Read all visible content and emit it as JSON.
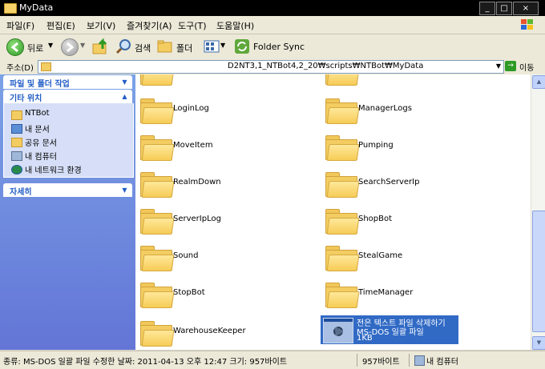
{
  "window": {
    "title": "MyData"
  },
  "menu": [
    "파일(F)",
    "편집(E)",
    "보기(V)",
    "즐겨찾기(A)",
    "도구(T)",
    "도움말(H)"
  ],
  "toolbar": {
    "back": "뒤로",
    "search": "검색",
    "folders": "폴더",
    "folder_sync": "Folder Sync"
  },
  "address": {
    "label": "주소(D)",
    "path": "D2NT3,1_NTBot4,2_20₩scripts₩NTBot₩MyData",
    "go": "이동"
  },
  "left_pane": {
    "group1": "파일 및 폴더 작업",
    "group2": "기타 위치",
    "places": [
      "NTBot",
      "내 문서",
      "공유 문서",
      "내 컴퓨터",
      "내 네트워크 환경"
    ],
    "group3": "자세히"
  },
  "files": [
    "LoginLog",
    "ManagerLogs",
    "MoveItem",
    "Pumping",
    "RealmDown",
    "SearchServerIp",
    "ServerIpLog",
    "ShopBot",
    "Sound",
    "StealGame",
    "StopBot",
    "TimeManager",
    "WarehouseKeeper"
  ],
  "selected_file": {
    "name": "전은 텍스트 파일 삭제하기",
    "type": "MS-DOS 일괄 파일",
    "size": "1KB"
  },
  "status": {
    "info": "종류: MS-DOS 일괄 파일 수정한 날짜: 2011-04-13 오후 12:47 크기: 957바이트",
    "size": "957바이트",
    "location": "내 컴퓨터"
  }
}
